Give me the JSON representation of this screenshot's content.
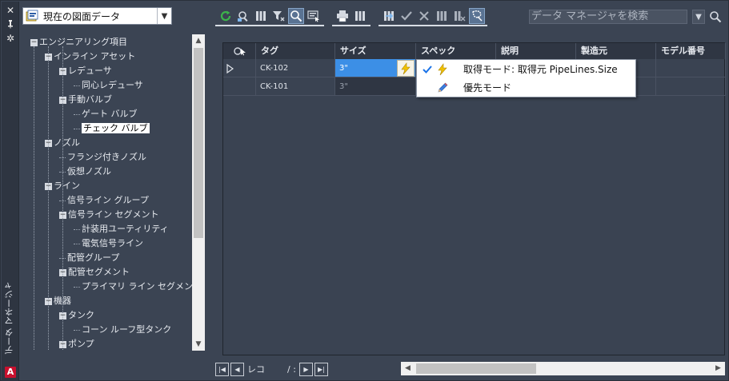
{
  "palette": {
    "background": "#3b4453",
    "edit_highlight": "#3c8fe6",
    "lightning": "#f2c200",
    "check": "#1a73e8"
  },
  "window": {
    "vertical_title": "データ マネージャ",
    "controls": [
      "close-icon",
      "pin-icon",
      "settings-icon"
    ],
    "app_logo": "A"
  },
  "view_selector": {
    "value": "現在の図面データ"
  },
  "tree": {
    "nodes": [
      {
        "label": "エンジニアリング項目",
        "level": 0,
        "expand": "−"
      },
      {
        "label": "インライン アセット",
        "level": 1,
        "expand": "−"
      },
      {
        "label": "レデューサ",
        "level": 2,
        "expand": "−"
      },
      {
        "label": "同心レデューサ",
        "level": 3,
        "expand": ""
      },
      {
        "label": "手動バルブ",
        "level": 2,
        "expand": "−"
      },
      {
        "label": "ゲート バルブ",
        "level": 3,
        "expand": ""
      },
      {
        "label": "チェック バルブ",
        "level": 3,
        "expand": "",
        "selected": true
      },
      {
        "label": "ノズル",
        "level": 1,
        "expand": "−"
      },
      {
        "label": "フランジ付きノズル",
        "level": 2,
        "expand": ""
      },
      {
        "label": "仮想ノズル",
        "level": 2,
        "expand": ""
      },
      {
        "label": "ライン",
        "level": 1,
        "expand": "−"
      },
      {
        "label": "信号ライン グループ",
        "level": 2,
        "expand": ""
      },
      {
        "label": "信号ライン セグメント",
        "level": 2,
        "expand": "−"
      },
      {
        "label": "計装用ユーティリティ",
        "level": 3,
        "expand": ""
      },
      {
        "label": "電気信号ライン",
        "level": 3,
        "expand": ""
      },
      {
        "label": "配管グループ",
        "level": 2,
        "expand": ""
      },
      {
        "label": "配管セグメント",
        "level": 2,
        "expand": "−"
      },
      {
        "label": "プライマリ ライン セグメント",
        "level": 3,
        "expand": ""
      },
      {
        "label": "機器",
        "level": 1,
        "expand": "−"
      },
      {
        "label": "タンク",
        "level": 2,
        "expand": "−"
      },
      {
        "label": "コーン ルーフ型タンク",
        "level": 3,
        "expand": ""
      },
      {
        "label": "ポンプ",
        "level": 2,
        "expand": "−"
      }
    ]
  },
  "toolbar": {
    "groups": [
      [
        "refresh-icon",
        "zoom-to-icon",
        "columns-icon",
        "filter-clear-icon",
        "search-zoom-icon",
        "select-icon"
      ],
      [
        "print-icon",
        "grid-icon"
      ],
      [
        "export-icon",
        "accept-icon",
        "reject-icon",
        "columns-settings-icon",
        "columns-remove-icon",
        "lasso-icon"
      ]
    ],
    "search_placeholder": "データ マネージャを検索"
  },
  "grid": {
    "columns": [
      "",
      "タグ",
      "サイズ",
      "スペック",
      "説明",
      "製造元",
      "モデル番号"
    ],
    "rows": [
      {
        "tag": "CK-102",
        "size": "3\"",
        "spec": "",
        "description": "",
        "manufacturer": "",
        "model": "",
        "editing": true
      },
      {
        "tag": "CK-101",
        "size": "3\"",
        "spec": "",
        "description": "",
        "manufacturer": "",
        "model": "",
        "editing": false
      }
    ]
  },
  "popup": {
    "items": [
      {
        "label": "取得モード: 取得元 PipeLines.Size",
        "checked": true,
        "icon": "lightning-icon"
      },
      {
        "label": "優先モード",
        "checked": false,
        "icon": "pencil-icon"
      }
    ]
  },
  "pager": {
    "label": "レコ",
    "separator": "/ :"
  }
}
